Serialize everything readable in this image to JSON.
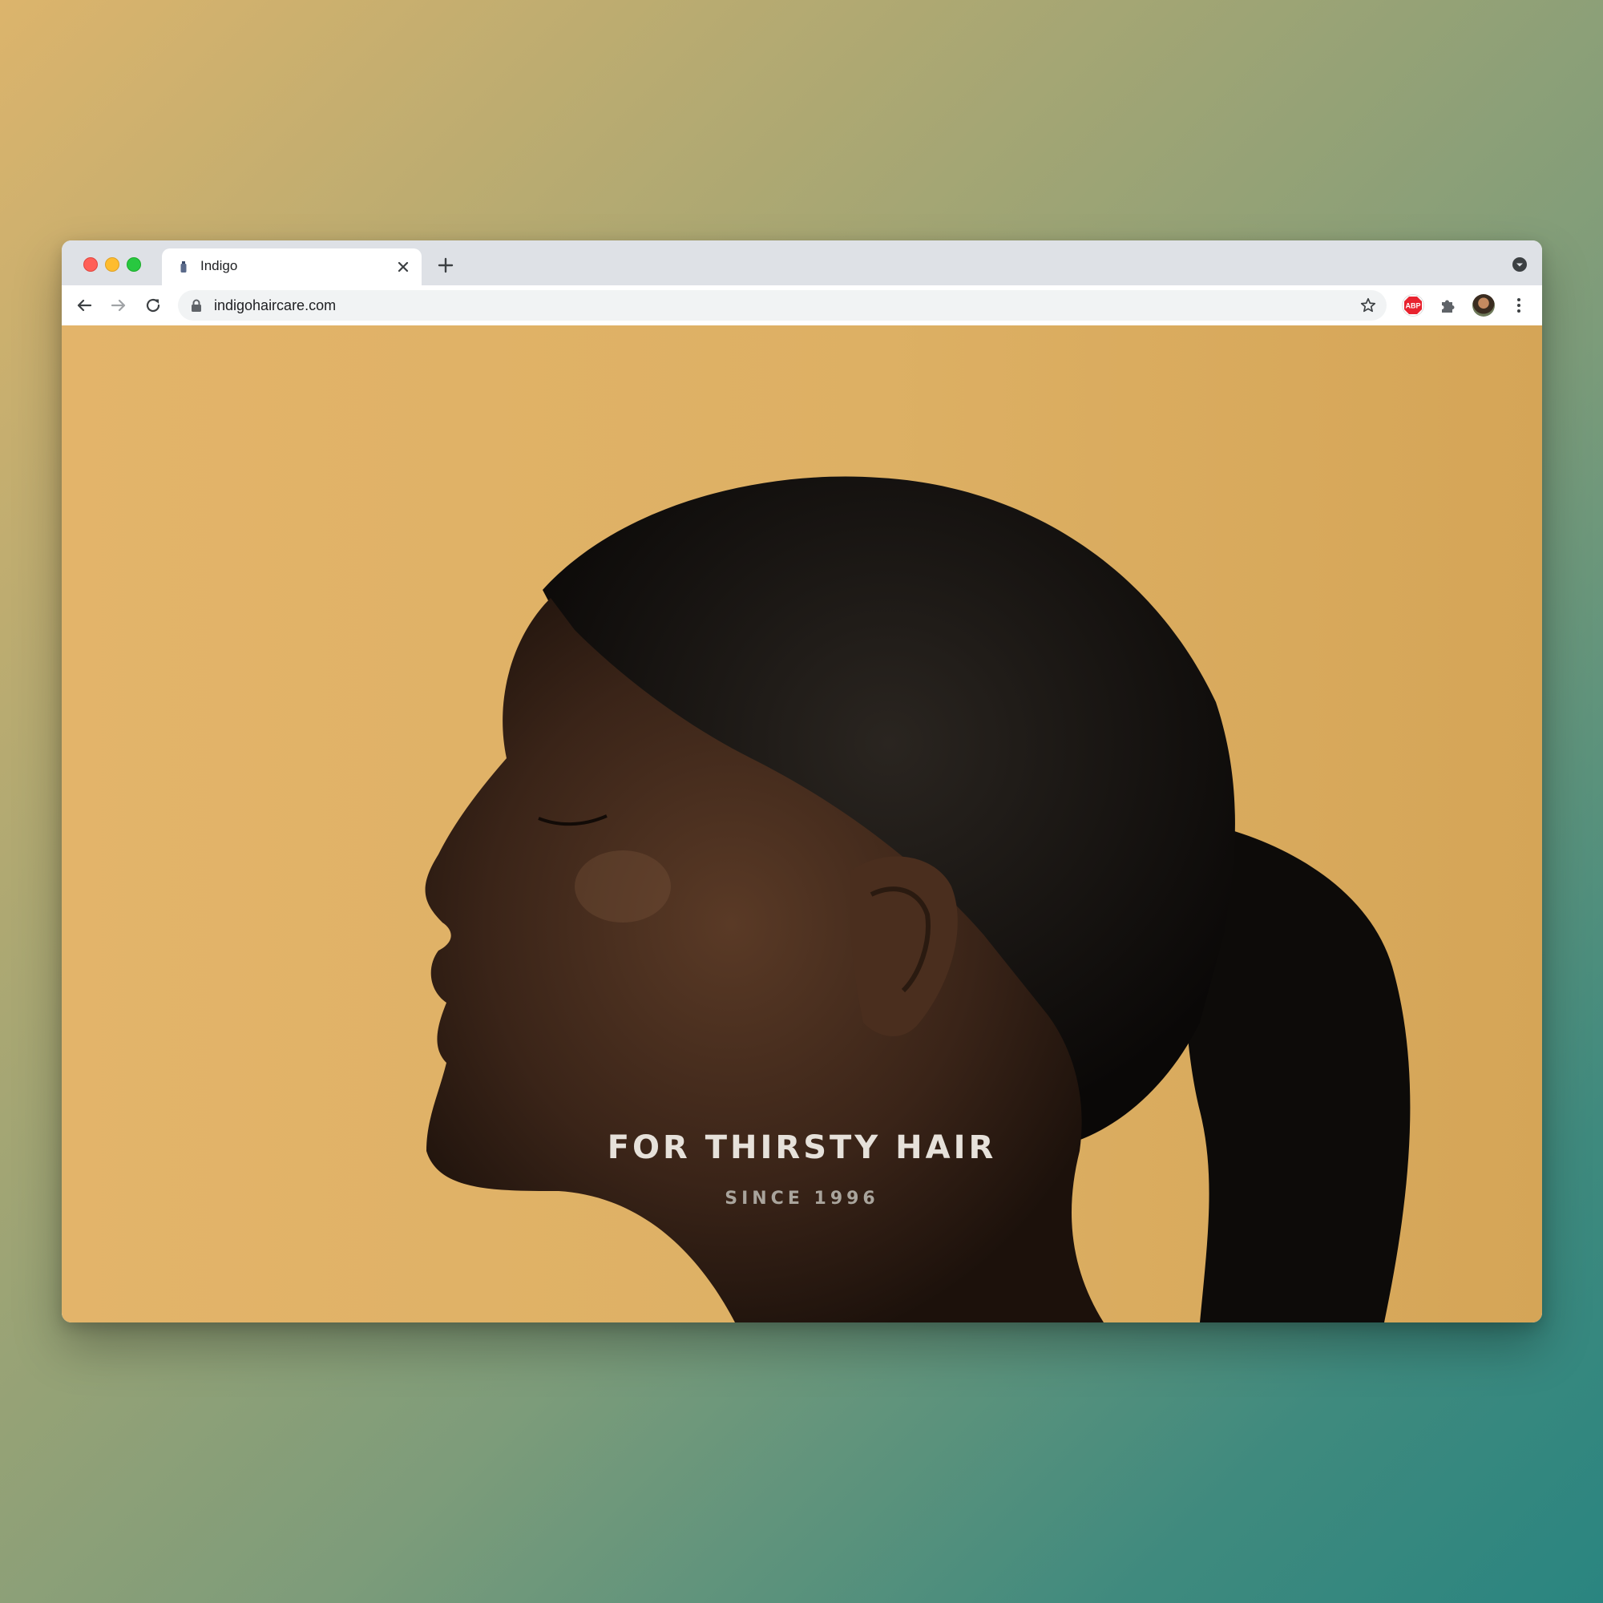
{
  "browser": {
    "tab": {
      "title": "Indigo"
    },
    "address_bar": {
      "url": "indigohaircare.com"
    },
    "extensions": {
      "abp_label": "ABP"
    }
  },
  "page": {
    "hero": {
      "headline": "FOR THIRSTY HAIR",
      "subheadline": "SINCE 1996"
    }
  },
  "colors": {
    "hero_background": "#ddb064",
    "headline_text": "#e6e1da",
    "subheadline_text": "#a9a49c",
    "abp_red": "#e8232f"
  },
  "icons": [
    "back-arrow-icon",
    "forward-arrow-icon",
    "reload-icon",
    "lock-icon",
    "star-icon",
    "abp-icon",
    "puzzle-icon",
    "kebab-menu-icon",
    "close-icon",
    "plus-icon",
    "tab-search-icon"
  ]
}
